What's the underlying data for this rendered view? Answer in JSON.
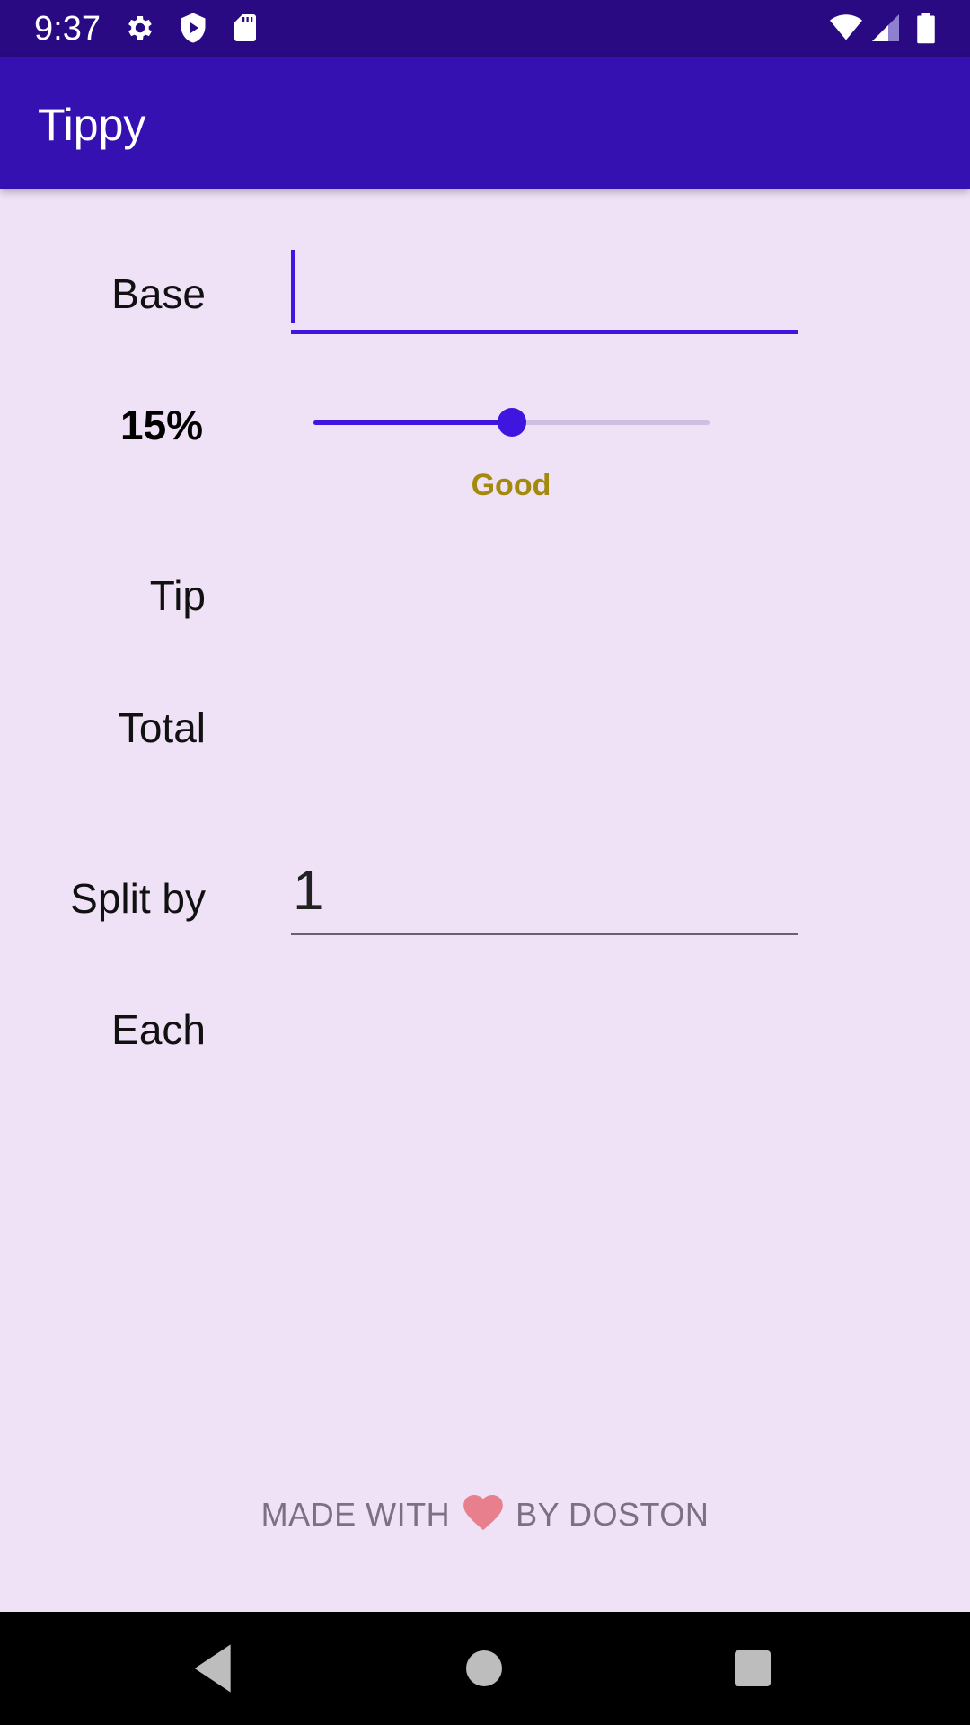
{
  "status_bar": {
    "time": "9:37",
    "icons_left": [
      "gear-icon",
      "shield-icon",
      "sd-card-icon"
    ],
    "icons_right": [
      "wifi-icon",
      "cell-signal-icon",
      "battery-icon"
    ]
  },
  "app_bar": {
    "title": "Tippy"
  },
  "form": {
    "base_label": "Base",
    "base_value": "",
    "tip_percent_label": "15%",
    "tip_percent": 15,
    "slider_fraction": 0.5,
    "tip_description": "Good",
    "tip_label": "Tip",
    "tip_value": "",
    "total_label": "Total",
    "total_value": "",
    "split_label": "Split by",
    "split_value": "1",
    "each_label": "Each",
    "each_value": ""
  },
  "footer": {
    "prefix": "MADE WITH",
    "heart_icon": "heart-icon",
    "suffix": "BY DOSTON"
  },
  "nav_bar": {
    "buttons": [
      "back-icon",
      "home-icon",
      "recents-icon"
    ]
  },
  "colors": {
    "status_bar": "#290a82",
    "app_bar": "#3511b1",
    "background": "#efe2f6",
    "accent": "#3e16e0",
    "tip_description": "#a38a0c",
    "heart": "#e87f8c"
  }
}
